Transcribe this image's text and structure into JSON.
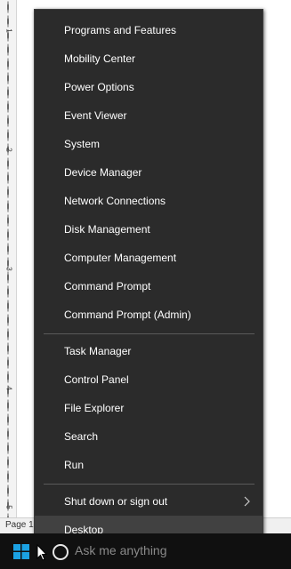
{
  "document": {
    "ruler_numbers": [
      "1",
      "2",
      "3",
      "4",
      "5"
    ],
    "status_text": "Page 1"
  },
  "menu": {
    "items": [
      {
        "label": "Programs and Features"
      },
      {
        "label": "Mobility Center"
      },
      {
        "label": "Power Options"
      },
      {
        "label": "Event Viewer"
      },
      {
        "label": "System"
      },
      {
        "label": "Device Manager"
      },
      {
        "label": "Network Connections"
      },
      {
        "label": "Disk Management"
      },
      {
        "label": "Computer Management"
      },
      {
        "label": "Command Prompt"
      },
      {
        "label": "Command Prompt (Admin)"
      },
      {
        "label": "Task Manager"
      },
      {
        "label": "Control Panel"
      },
      {
        "label": "File Explorer"
      },
      {
        "label": "Search"
      },
      {
        "label": "Run"
      },
      {
        "label": "Shut down or sign out",
        "submenu": true
      },
      {
        "label": "Desktop",
        "highlighted": true
      }
    ]
  },
  "taskbar": {
    "search_placeholder": "Ask me anything",
    "start_icon": "windows-logo-icon",
    "cortana_icon": "cortana-circle-icon"
  },
  "colors": {
    "menu_bg": "#2b2b2b",
    "menu_hover": "#414141",
    "taskbar_bg": "#101010",
    "start_accent": "#1ba1e2"
  }
}
